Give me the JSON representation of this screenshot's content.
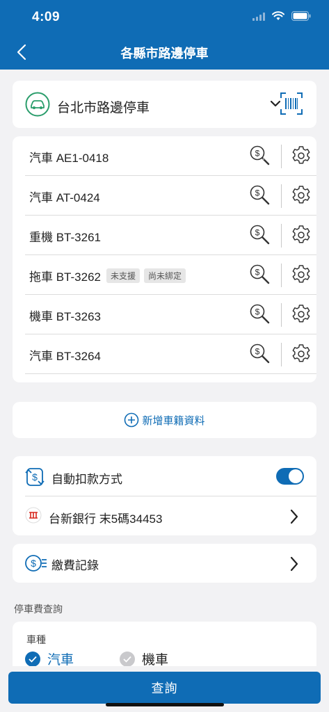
{
  "status": {
    "time": "4:09"
  },
  "nav": {
    "title": "各縣市路邊停車"
  },
  "city": {
    "label": "台北市路邊停車"
  },
  "vehicles": [
    {
      "label": "汽車 AE1-0418",
      "tags": []
    },
    {
      "label": "汽車 AT-0424",
      "tags": []
    },
    {
      "label": "重機 BT-3261",
      "tags": []
    },
    {
      "label": "拖車 BT-3262",
      "tags": [
        "未支援",
        "尚未綁定"
      ]
    },
    {
      "label": "機車 BT-3263",
      "tags": []
    },
    {
      "label": "汽車 BT-3264",
      "tags": []
    }
  ],
  "add_vehicle": {
    "label": "新增車籍資料"
  },
  "autopay": {
    "label": "自動扣款方式",
    "enabled": true,
    "bank_label": "台新銀行 末5碼34453"
  },
  "history": {
    "label": "繳費記錄"
  },
  "query": {
    "section_title": "停車費查詢",
    "vehicle_type_label": "車種",
    "options": [
      {
        "label": "汽車",
        "selected": true
      },
      {
        "label": "機車",
        "selected": false
      }
    ],
    "submit_label": "查詢"
  },
  "colors": {
    "primary": "#0f6cb5",
    "accent_green": "#2a9d6b",
    "bank_red": "#d7261c"
  },
  "icons": [
    "back-icon",
    "wifi-icon",
    "battery-icon",
    "car-icon",
    "chevron-down-icon",
    "barcode-scan-icon",
    "search-dollar-icon",
    "gear-icon",
    "plus-circle-icon",
    "dollar-cycle-icon",
    "bank-logo-icon",
    "chevron-right-icon",
    "dollar-list-icon",
    "check-icon"
  ]
}
